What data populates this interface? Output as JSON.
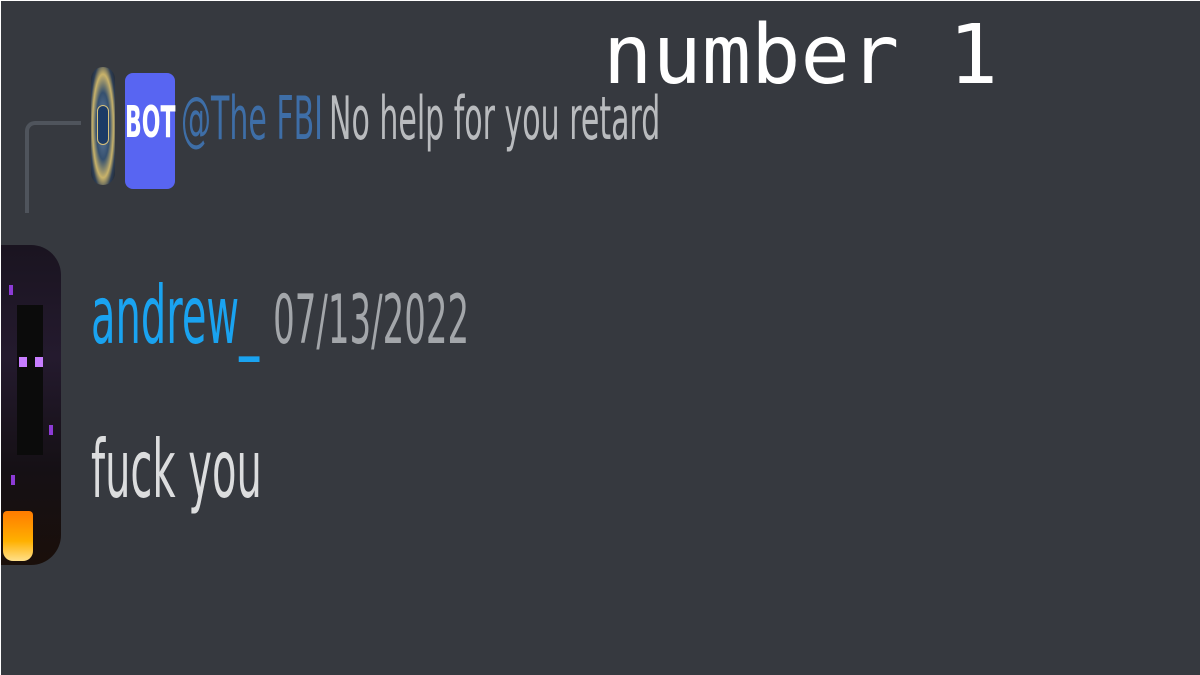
{
  "caption": "number 1",
  "reply": {
    "avatar_icon": "fbi-seal-icon",
    "badge": "BOT",
    "mention": "@The FBI",
    "content": "No help for you retard"
  },
  "message": {
    "avatar_icon": "enderman-avatar-icon",
    "username": "andrew_",
    "timestamp": "07/13/2022",
    "content": "fuck you"
  },
  "colors": {
    "background": "#36393f",
    "bot_badge": "#5865f2",
    "username": "#1aa3f0"
  }
}
